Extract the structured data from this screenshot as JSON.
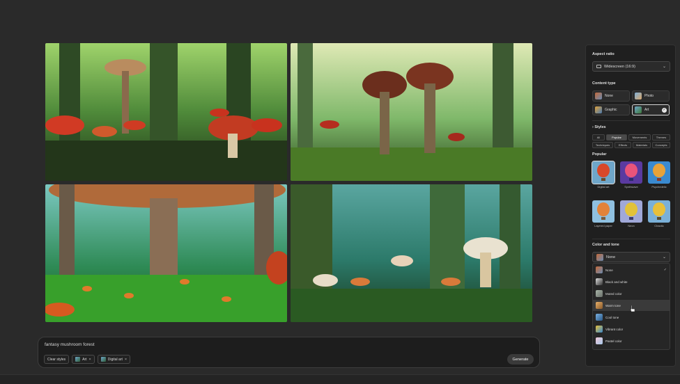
{
  "prompt": {
    "text": "fantasy mushroom forest",
    "chips": [
      {
        "label": "Clear styles",
        "has_thumb": false,
        "removable": false
      },
      {
        "label": "Art",
        "has_thumb": true,
        "removable": true
      },
      {
        "label": "Digital art",
        "has_thumb": true,
        "removable": true
      }
    ],
    "remove_glyph": "×",
    "generate_label": "Generate"
  },
  "panel": {
    "aspect_ratio": {
      "label": "Aspect ratio",
      "value": "Widescreen (16:9)"
    },
    "content_type": {
      "label": "Content type",
      "options": [
        {
          "label": "None",
          "selected": false
        },
        {
          "label": "Photo",
          "selected": false
        },
        {
          "label": "Graphic",
          "selected": false
        },
        {
          "label": "Art",
          "selected": true
        }
      ]
    },
    "styles": {
      "label": "Styles",
      "tabs": [
        "All",
        "Popular",
        "Movements",
        "Themes",
        "Techniques",
        "Effects",
        "Materials",
        "Concepts"
      ],
      "selected_tab": "Popular"
    },
    "popular": {
      "label": "Popular",
      "items": [
        "Digital art",
        "Synthwave",
        "Psychedelic",
        "Layered paper",
        "Neon",
        "Chaotic"
      ]
    },
    "color_tone": {
      "label": "Color and tone",
      "value": "None",
      "options": [
        "None",
        "Black and white",
        "Muted color",
        "Warm tone",
        "Cool tone",
        "Vibrant color",
        "Pastel color"
      ],
      "hovered": "Warm tone"
    }
  },
  "colors": {
    "accent": "#e6e6e6",
    "panel_bg": "#1f1f1f",
    "page_bg": "#2a2a2a"
  }
}
